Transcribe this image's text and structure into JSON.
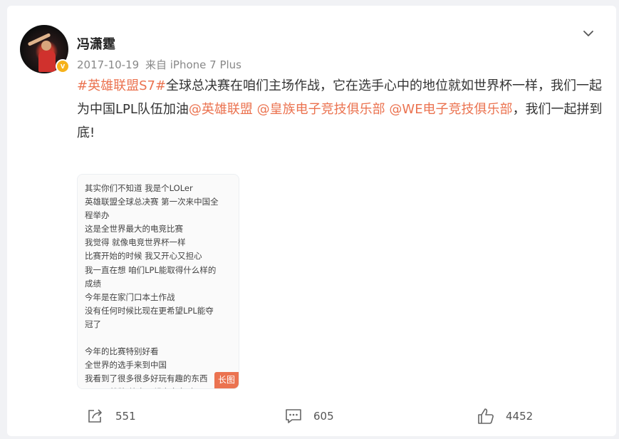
{
  "post": {
    "author": "冯潇霆",
    "verified_mark": "v",
    "date": "2017-10-19",
    "source": "来自 iPhone 7 Plus",
    "content": {
      "hashtag": "#英雄联盟S7#",
      "text1": "全球总决赛在咱们主场作战，它在选手心中的地位就如世界杯一样，我们一起为中国LPL队伍加油",
      "mention1": "@英雄联盟",
      "mention2": "@皇族电子竞技俱乐部",
      "mention3": "@WE电子竞技俱乐部",
      "text2": "，我们一起拼到底!"
    },
    "long_image": {
      "badge": "长图",
      "lines": [
        "其实你们不知道 我是个LOLer",
        "英雄联盟全球总决赛 第一次来中国全",
        "程举办",
        "这是全世界最大的电竞比赛",
        "我觉得 就像电竞世界杯一样",
        "比赛开始的时候 我又开心又担心",
        "我一直在想 咱们LPL能取得什么样的",
        "成绩",
        "今年是在家门口本土作战",
        "没有任何时候比现在更希望LPL能夺",
        "冠了",
        "",
        "今年的比赛特别好看",
        "全世界的选手来到中国",
        "我看到了很多很多好玩有趣的东西",
        "Fnatic战队 给自己起中文名 有"
      ]
    },
    "actions": {
      "shares": "551",
      "comments": "605",
      "likes": "4452"
    },
    "icons": {
      "menu": "chevron-down-icon",
      "share": "share-icon",
      "comment": "comment-icon",
      "like": "thumbs-up-icon"
    },
    "colors": {
      "accent": "#eb7350",
      "verified": "#f6b21b"
    }
  }
}
